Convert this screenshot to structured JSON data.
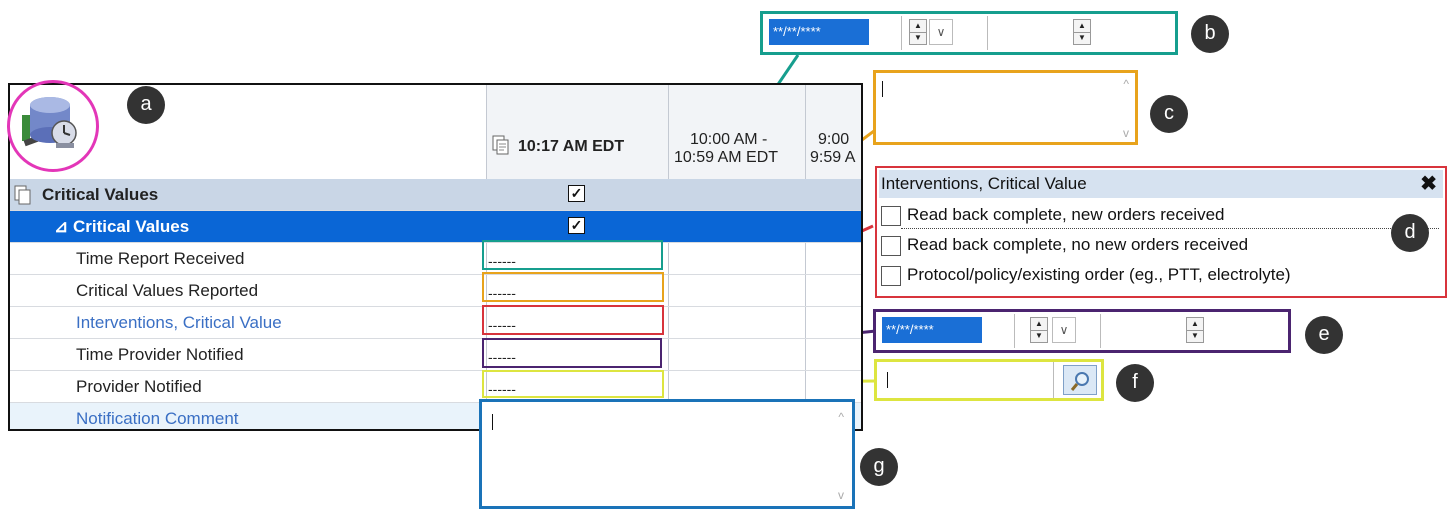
{
  "flowsheet": {
    "columns": [
      {
        "label": "10:17 AM EDT"
      },
      {
        "label_line1": "10:00 AM -",
        "label_line2": "10:59 AM EDT"
      },
      {
        "label_line1": "9:00",
        "label_line2": "9:59 A"
      }
    ],
    "rows": [
      {
        "label": "Critical Values",
        "kind": "section",
        "checked": true
      },
      {
        "label": "⊿ Critical Values",
        "kind": "selected",
        "checked": true
      },
      {
        "label": "Time Report Received",
        "value": "------"
      },
      {
        "label": "Critical Values Reported",
        "value": "------"
      },
      {
        "label": "Interventions, Critical Value",
        "value": "------"
      },
      {
        "label": "Time Provider Notified",
        "value": "------"
      },
      {
        "label": "Provider Notified",
        "value": "------"
      },
      {
        "label": "Notification Comment"
      }
    ],
    "checkmark": "✓"
  },
  "callouts": [
    "a",
    "b",
    "c",
    "d",
    "e",
    "f",
    "g"
  ],
  "controls": {
    "date_b": {
      "value": "**/**/****"
    },
    "date_e": {
      "value": "**/**/****"
    },
    "spin_up": "▲",
    "spin_down": "▼",
    "dropdown": "∨",
    "scroll_up": "^",
    "scroll_down": "v"
  },
  "interventions": {
    "title": "Interventions, Critical Value",
    "close": "✖",
    "options": [
      "Read back complete, new orders received",
      "Read back complete, no new orders received",
      "Protocol/policy/existing order (eg., PTT, electrolyte)"
    ]
  },
  "colors": {
    "teal": "#169e8e",
    "orange": "#e8a31c",
    "red": "#d8343c",
    "purple": "#4b2470",
    "yellow": "#dde540",
    "blue": "#1a73b8",
    "magenta": "#e336b8",
    "selection": "#0a66d6"
  },
  "icons": [
    "app-database-clock-icon",
    "document-icon",
    "search-icon",
    "close-icon"
  ]
}
